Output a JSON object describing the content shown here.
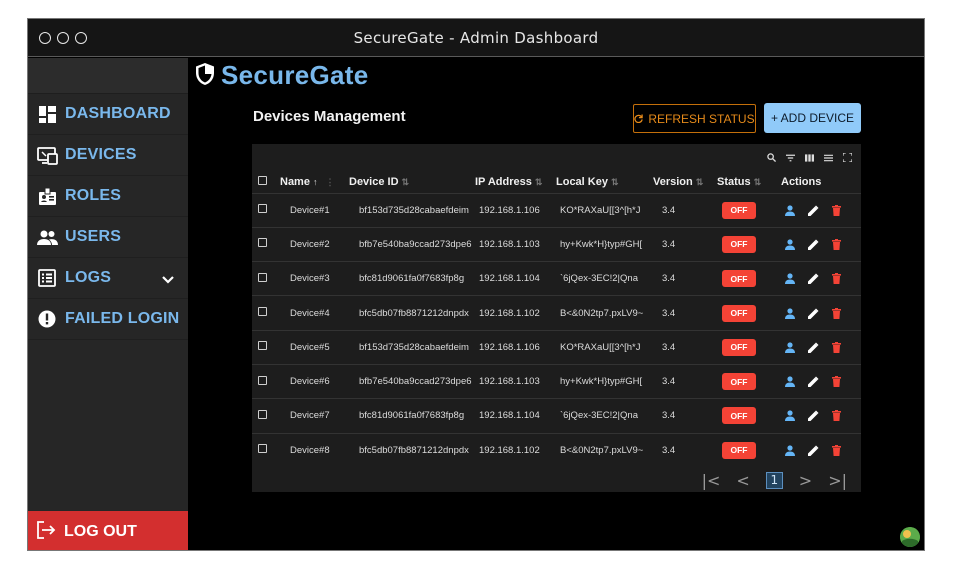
{
  "window": {
    "title": "SecureGate - Admin Dashboard"
  },
  "brand": {
    "name": "SecureGate",
    "icon": "shield-icon"
  },
  "sidebar": {
    "items": [
      {
        "label": "DASHBOARD",
        "icon": "dashboard-icon"
      },
      {
        "label": "DEVICES",
        "icon": "devices-icon"
      },
      {
        "label": "ROLES",
        "icon": "roles-icon"
      },
      {
        "label": "USERS",
        "icon": "users-icon"
      },
      {
        "label": "LOGS",
        "icon": "logs-icon"
      },
      {
        "label": "FAILED LOGIN",
        "icon": "alert-icon"
      }
    ],
    "logout": {
      "label": "LOG OUT",
      "icon": "logout-icon"
    }
  },
  "main": {
    "page_title": "Devices Management",
    "refresh_label": "REFRESH STATUS",
    "add_label": "+ ADD DEVICE"
  },
  "table": {
    "columns": [
      "Name",
      "Device ID",
      "IP Address",
      "Local Key",
      "Version",
      "Status",
      "Actions"
    ],
    "rows": [
      {
        "name": "Device#1",
        "device_id": "bf153d735d28cabaefdeim",
        "ip": "192.168.1.106",
        "local_key": "KO*RAXaU[[3^[h*J",
        "version": "3.4",
        "status": "OFF"
      },
      {
        "name": "Device#2",
        "device_id": "bfb7e540ba9ccad273dpe6",
        "ip": "192.168.1.103",
        "local_key": "hy+Kwk*H}typ#GH[",
        "version": "3.4",
        "status": "OFF"
      },
      {
        "name": "Device#3",
        "device_id": "bfc81d9061fa0f7683fp8g",
        "ip": "192.168.1.104",
        "local_key": "`6jQex-3EC!2|Qna",
        "version": "3.4",
        "status": "OFF"
      },
      {
        "name": "Device#4",
        "device_id": "bfc5db07fb8871212dnpdx",
        "ip": "192.168.1.102",
        "local_key": "B<&0N2tp7.pxLV9~",
        "version": "3.4",
        "status": "OFF"
      },
      {
        "name": "Device#5",
        "device_id": "bf153d735d28cabaefdeim",
        "ip": "192.168.1.106",
        "local_key": "KO*RAXaU[[3^[h*J",
        "version": "3.4",
        "status": "OFF"
      },
      {
        "name": "Device#6",
        "device_id": "bfb7e540ba9ccad273dpe6",
        "ip": "192.168.1.103",
        "local_key": "hy+Kwk*H}typ#GH[",
        "version": "3.4",
        "status": "OFF"
      },
      {
        "name": "Device#7",
        "device_id": "bfc81d9061fa0f7683fp8g",
        "ip": "192.168.1.104",
        "local_key": "`6jQex-3EC!2|Qna",
        "version": "3.4",
        "status": "OFF"
      },
      {
        "name": "Device#8",
        "device_id": "bfc5db07fb8871212dnpdx",
        "ip": "192.168.1.102",
        "local_key": "B<&0N2tp7.pxLV9~",
        "version": "3.4",
        "status": "OFF"
      }
    ]
  },
  "pagination": {
    "current_page": "1"
  },
  "colors": {
    "accent": "#79b7ea",
    "danger": "#f44336",
    "warning": "#e58a1a",
    "primary_button": "#90caf9",
    "logout": "#d32f2f"
  }
}
